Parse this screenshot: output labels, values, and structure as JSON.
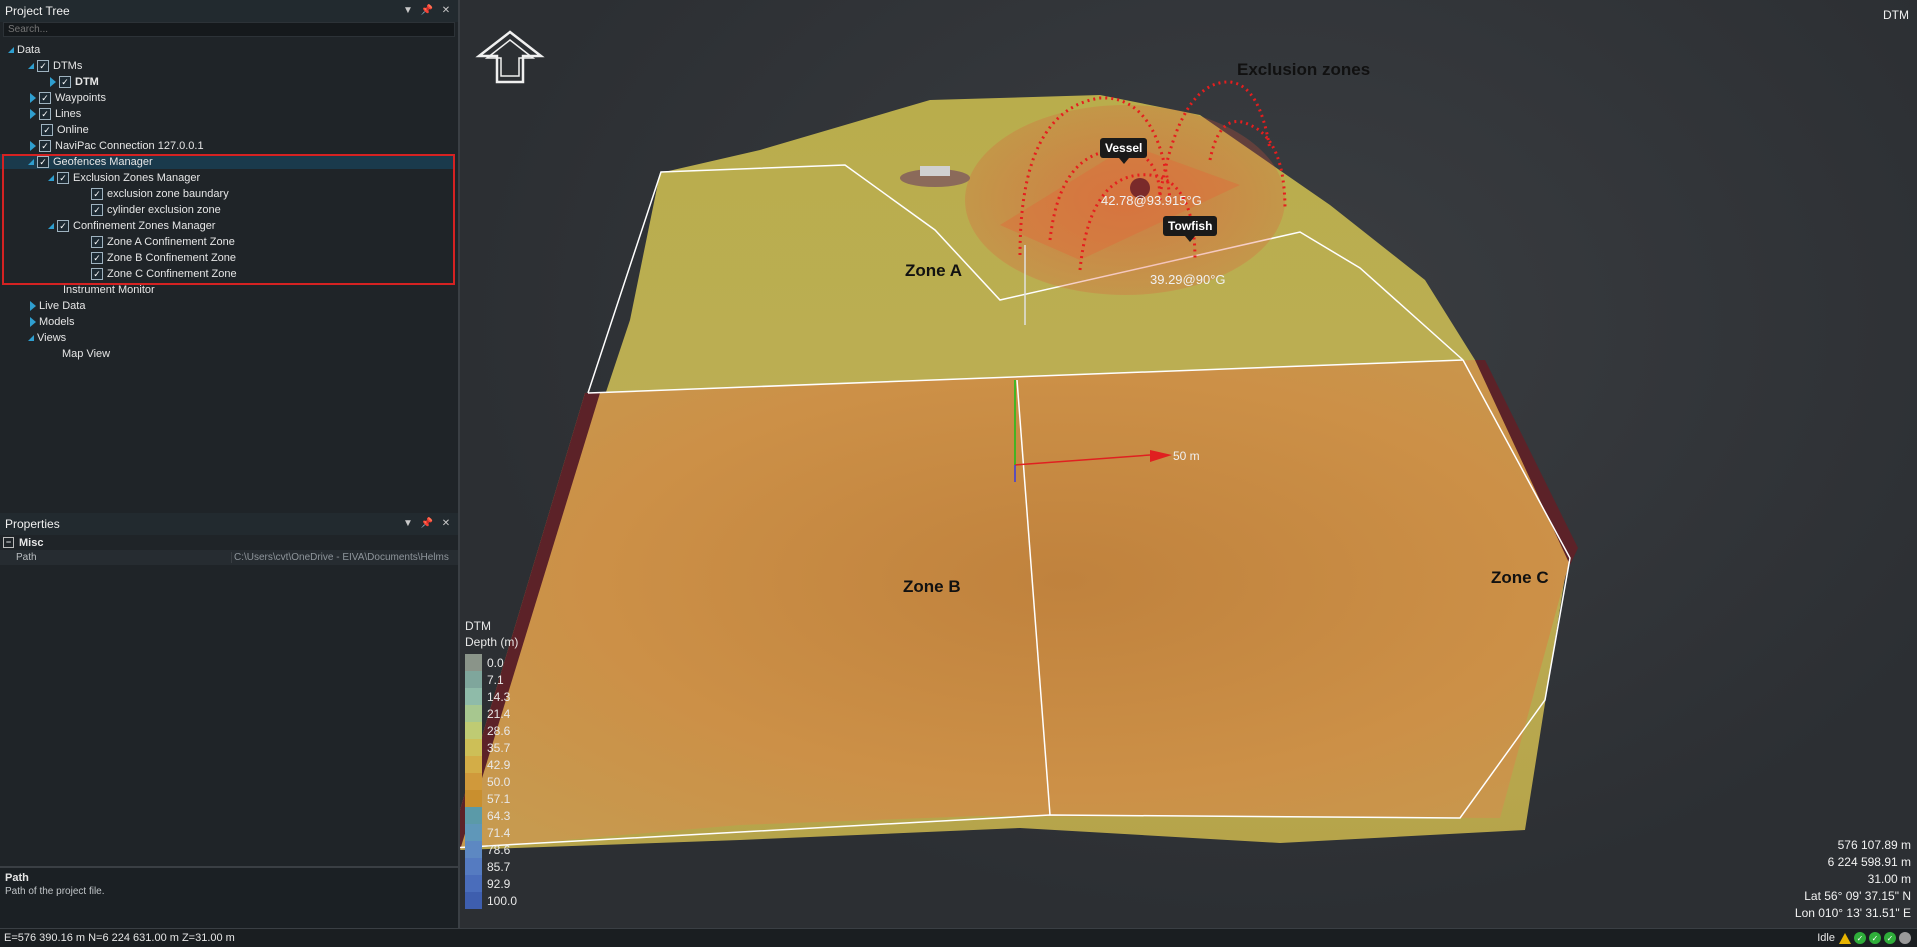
{
  "project_tree": {
    "title": "Project Tree",
    "search_placeholder": "Search...",
    "items": [
      {
        "label": "Data",
        "level": 0,
        "expander": "open",
        "checkbox": false,
        "bold": false
      },
      {
        "label": "DTMs",
        "level": 1,
        "expander": "open",
        "checkbox": true,
        "bold": false
      },
      {
        "label": "DTM",
        "level": 2,
        "expander": "closed",
        "checkbox": true,
        "bold": true
      },
      {
        "label": "Waypoints",
        "level": 1,
        "expander": "closed",
        "checkbox": true,
        "bold": false
      },
      {
        "label": "Lines",
        "level": 1,
        "expander": "closed",
        "checkbox": true,
        "bold": false
      },
      {
        "label": "Online",
        "level": 1,
        "expander": "none",
        "checkbox": true,
        "bold": false
      },
      {
        "label": "NaviPac Connection 127.0.0.1",
        "level": 1,
        "expander": "closed",
        "checkbox": true,
        "bold": false
      },
      {
        "label": "Geofences Manager",
        "level": 1,
        "expander": "open",
        "checkbox": true,
        "bold": false,
        "selected": true
      },
      {
        "label": "Exclusion Zones Manager",
        "level": 2,
        "expander": "open",
        "checkbox": true,
        "bold": false
      },
      {
        "label": "exclusion zone baundary",
        "level": 3,
        "expander": "none",
        "checkbox": true,
        "bold": false
      },
      {
        "label": "cylinder exclusion zone",
        "level": 3,
        "expander": "none",
        "checkbox": true,
        "bold": false
      },
      {
        "label": "Confinement Zones Manager",
        "level": 2,
        "expander": "open",
        "checkbox": true,
        "bold": false
      },
      {
        "label": "Zone A Confinement Zone",
        "level": 3,
        "expander": "none",
        "checkbox": true,
        "bold": false
      },
      {
        "label": "Zone B Confinement Zone",
        "level": 3,
        "expander": "none",
        "checkbox": true,
        "bold": false
      },
      {
        "label": "Zone C Confinement Zone",
        "level": 3,
        "expander": "none",
        "checkbox": true,
        "bold": false
      },
      {
        "label": "Instrument Monitor",
        "level": 1,
        "expander": "none",
        "checkbox": false,
        "bold": false
      },
      {
        "label": "Live Data",
        "level": 1,
        "expander": "closed",
        "checkbox": false,
        "bold": false
      },
      {
        "label": "Models",
        "level": 1,
        "expander": "closed",
        "checkbox": false,
        "bold": false
      },
      {
        "label": "Views",
        "level": 1,
        "expander": "open",
        "checkbox": false,
        "bold": false
      },
      {
        "label": "Map View",
        "level": 2,
        "expander": "none",
        "checkbox": false,
        "bold": false
      }
    ]
  },
  "properties": {
    "title": "Properties",
    "category": "Misc",
    "rows": [
      {
        "key": "Path",
        "value": "C:\\Users\\cvt\\OneDrive - EIVA\\Documents\\Helms"
      }
    ],
    "description_title": "Path",
    "description_text": "Path of the project file."
  },
  "view": {
    "corner_label": "DTM",
    "title_annotation": "Exclusion zones",
    "zones": [
      "Zone A",
      "Zone B",
      "Zone C"
    ],
    "vessel_tag": "Vessel",
    "towfish_tag": "Towfish",
    "vessel_measure": "42.78@93.915°G",
    "towfish_measure": "39.29@90°G",
    "scale_label": "50 m",
    "legend": {
      "title": "DTM",
      "unit": "Depth (m)",
      "entries": [
        {
          "value": "0.0",
          "color": "#8a9489"
        },
        {
          "value": "7.1",
          "color": "#7fa69c"
        },
        {
          "value": "14.3",
          "color": "#8fbba9"
        },
        {
          "value": "21.4",
          "color": "#a7c78f"
        },
        {
          "value": "28.6",
          "color": "#bfcb73"
        },
        {
          "value": "35.7",
          "color": "#cdbf57"
        },
        {
          "value": "42.9",
          "color": "#d3ad47"
        },
        {
          "value": "50.0",
          "color": "#d0993b"
        },
        {
          "value": "57.1",
          "color": "#c98f2e"
        },
        {
          "value": "64.3",
          "color": "#5b9aa8"
        },
        {
          "value": "71.4",
          "color": "#5f97b9"
        },
        {
          "value": "78.6",
          "color": "#5d88c2"
        },
        {
          "value": "85.7",
          "color": "#557bc1"
        },
        {
          "value": "92.9",
          "color": "#4a6dbb"
        },
        {
          "value": "100.0",
          "color": "#3e5eae"
        }
      ]
    },
    "coords": {
      "easting": "576 107.89 m",
      "northing": "6 224 598.91 m",
      "z": "31.00 m",
      "lat": "Lat 56° 09' 37.15\" N",
      "lon": "Lon 010° 13' 31.51\" E"
    }
  },
  "status_bar": {
    "coords": "E=576 390.16 m N=6 224 631.00 m Z=31.00 m",
    "state": "Idle"
  }
}
